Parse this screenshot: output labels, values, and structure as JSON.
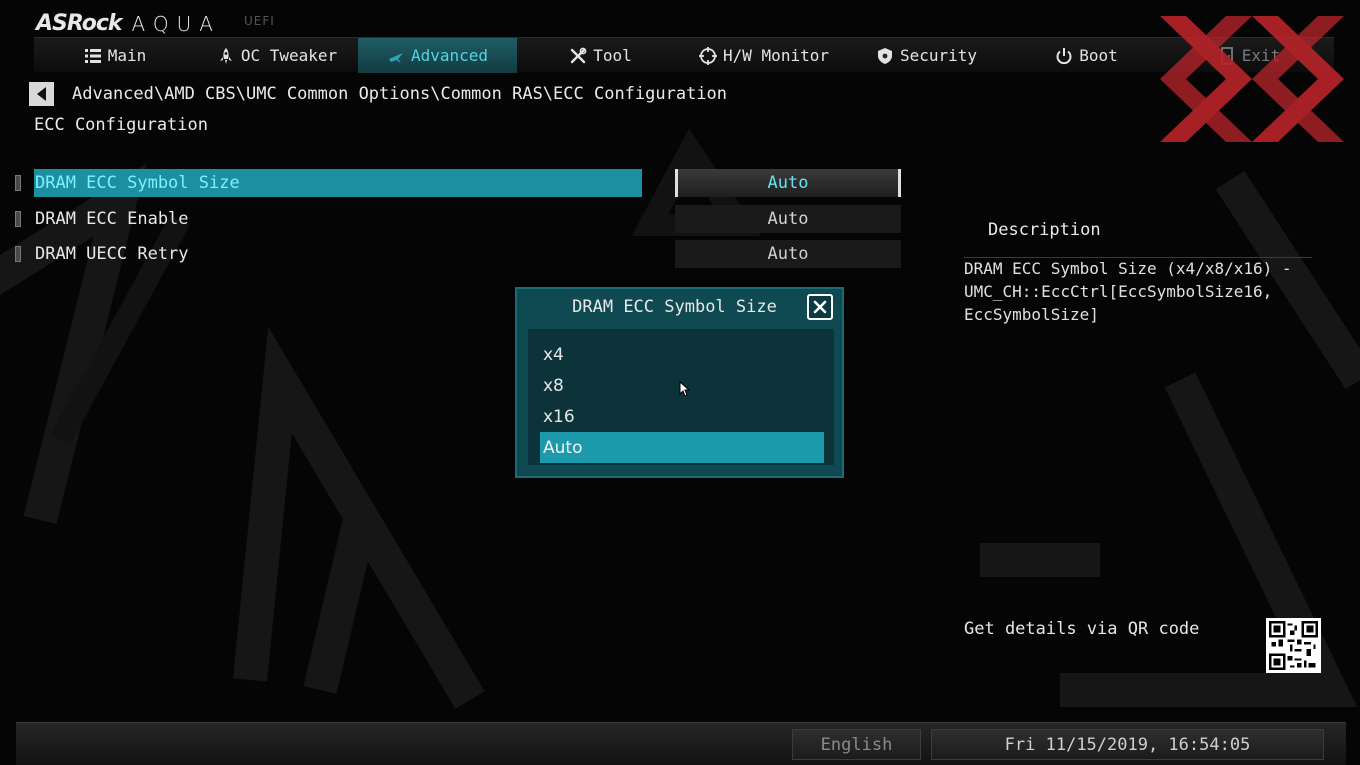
{
  "brand": {
    "name": "ASRock",
    "product": "AQUA",
    "tag": "UEFI"
  },
  "nav": {
    "tabs": [
      {
        "label": "Main",
        "icon": "list-icon"
      },
      {
        "label": "OC Tweaker",
        "icon": "rocket-icon"
      },
      {
        "label": "Advanced",
        "icon": "star-icon",
        "active": true
      },
      {
        "label": "Tool",
        "icon": "tools-icon"
      },
      {
        "label": "H/W Monitor",
        "icon": "crosshair-icon"
      },
      {
        "label": "Security",
        "icon": "shield-icon"
      },
      {
        "label": "Boot",
        "icon": "power-icon"
      },
      {
        "label": "Exit",
        "icon": "exit-door-icon"
      }
    ]
  },
  "breadcrumb": "Advanced\\AMD CBS\\UMC Common Options\\Common RAS\\ECC Configuration",
  "page_title": "ECC Configuration",
  "settings": [
    {
      "label": "DRAM ECC Symbol Size",
      "value": "Auto",
      "selected": true
    },
    {
      "label": "DRAM ECC Enable",
      "value": "Auto"
    },
    {
      "label": "DRAM UECC Retry",
      "value": "Auto"
    }
  ],
  "description": {
    "title": "Description",
    "text": "DRAM ECC Symbol Size (x4/x8/x16) - UMC_CH::EccCtrl[EccSymbolSize16, EccSymbolSize]",
    "qr_label": "Get details via QR code"
  },
  "popup": {
    "title": "DRAM ECC Symbol Size",
    "options": [
      "x4",
      "x8",
      "x16",
      "Auto"
    ],
    "selected": "Auto"
  },
  "footer": {
    "language": "English",
    "datetime": "Fri 11/15/2019, 16:54:05"
  },
  "colors": {
    "accent": "#1c8fa0",
    "accent_text": "#52d4e2",
    "popup_bg": "#0f4a52",
    "watermark_red": "#c0262c"
  }
}
